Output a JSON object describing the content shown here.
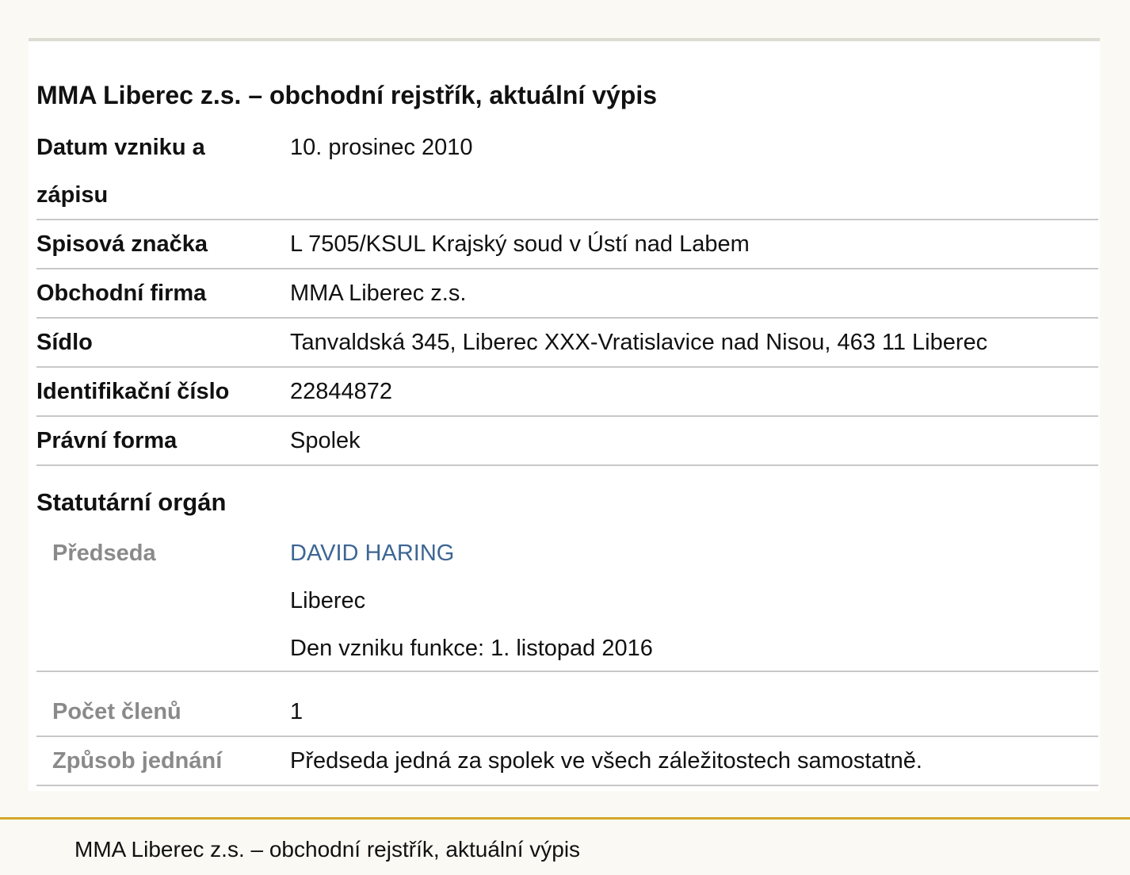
{
  "title": "MMA Liberec z.s. – obchodní rejstřík, aktuální výpis",
  "rows": [
    {
      "label": "Datum vzniku a zápisu",
      "value": "10. prosinec 2010"
    },
    {
      "label": "Spisová značka",
      "value": "L 7505/KSUL Krajský soud v Ústí nad Labem"
    },
    {
      "label": "Obchodní firma",
      "value": "MMA Liberec z.s."
    },
    {
      "label": "Sídlo",
      "value": "Tanvaldská 345, Liberec XXX-Vratislavice nad Nisou, 463 11 Liberec"
    },
    {
      "label": "Identifikační číslo",
      "value": "22844872"
    },
    {
      "label": "Právní forma",
      "value": "Spolek"
    }
  ],
  "statutory": {
    "heading": "Statutární orgán",
    "chairman": {
      "label": "Předseda",
      "name": "DAVID HARING",
      "city": "Liberec",
      "since": "Den vzniku funkce: 1. listopad 2016"
    },
    "members": {
      "label": "Počet členů",
      "value": "1"
    },
    "conduct": {
      "label": "Způsob jednání",
      "value": "Předseda jedná za spolek ve všech záležitostech samostatně."
    }
  },
  "footer": {
    "text": "MMA Liberec z.s. – obchodní rejstřík, aktuální výpis"
  },
  "colors": {
    "background": "#faf9f3",
    "panel": "#ffffff",
    "link": "#3d6694",
    "sub_label": "#8a8a8a",
    "footer_border": "#d4a72c"
  }
}
